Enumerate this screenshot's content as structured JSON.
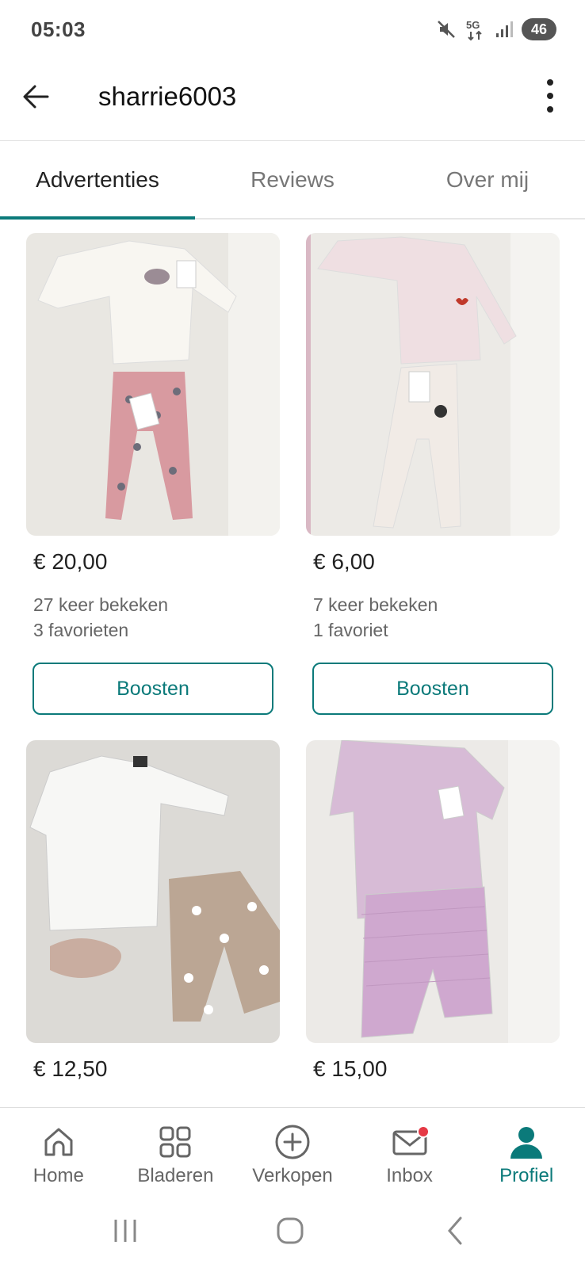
{
  "status_bar": {
    "time": "05:03",
    "network": "5G",
    "battery": "46",
    "icons": [
      "mute-icon",
      "5g-icon",
      "signal-icon",
      "battery-icon"
    ]
  },
  "header": {
    "title": "sharrie6003"
  },
  "tabs": [
    {
      "label": "Advertenties",
      "active": true
    },
    {
      "label": "Reviews",
      "active": false
    },
    {
      "label": "Over mij",
      "active": false
    }
  ],
  "listings": [
    {
      "price": "€ 20,00",
      "views": "27 keer bekeken",
      "favorites": "3 favorieten",
      "button": "Boosten"
    },
    {
      "price": "€ 6,00",
      "views": "7 keer bekeken",
      "favorites": "1 favoriet",
      "button": "Boosten"
    },
    {
      "price": "€ 12,50"
    },
    {
      "price": "€ 15,00"
    }
  ],
  "bottom_nav": [
    {
      "label": "Home",
      "icon": "home-icon",
      "active": false
    },
    {
      "label": "Bladeren",
      "icon": "grid-icon",
      "active": false
    },
    {
      "label": "Verkopen",
      "icon": "plus-circle-icon",
      "active": false
    },
    {
      "label": "Inbox",
      "icon": "mail-icon",
      "active": false,
      "badge": true
    },
    {
      "label": "Profiel",
      "icon": "person-icon",
      "active": true
    }
  ],
  "colors": {
    "accent": "#0b7a7a",
    "badge": "#e53945"
  }
}
